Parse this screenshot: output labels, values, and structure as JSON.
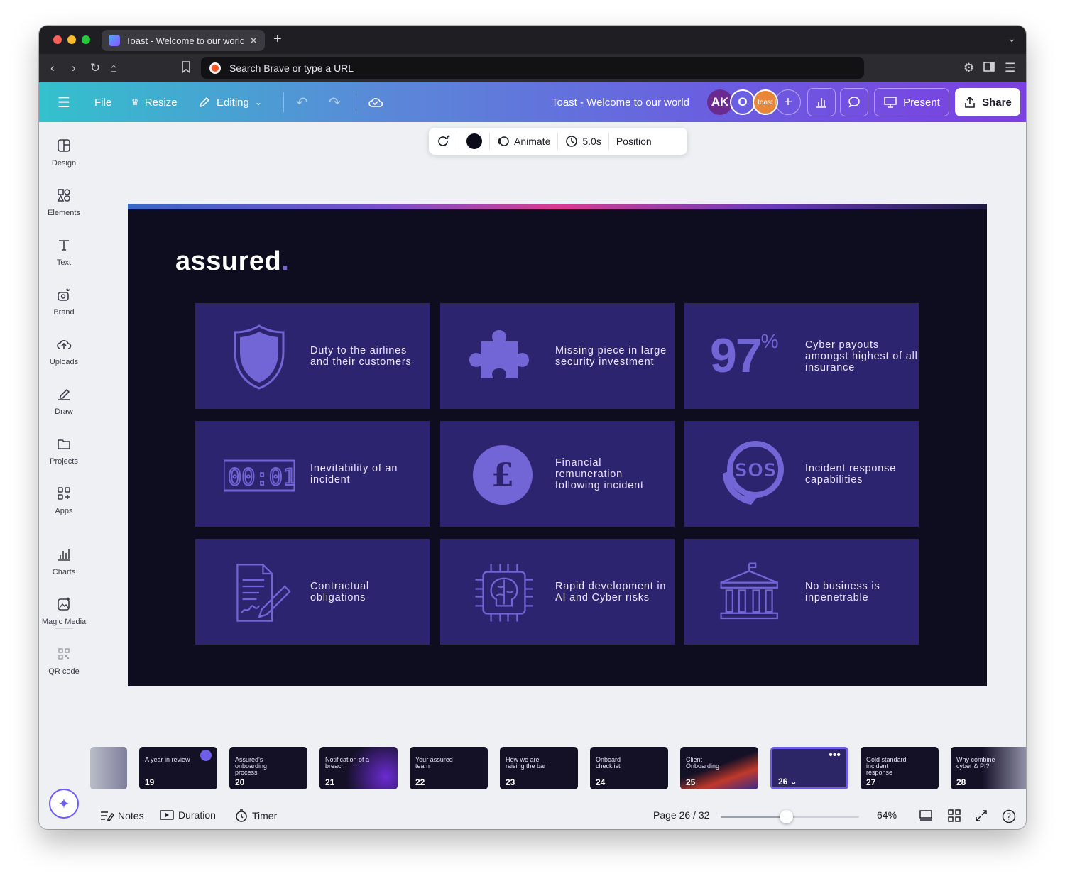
{
  "browser": {
    "tab_title": "Toast - Welcome to our world",
    "url_placeholder": "Search Brave or type a URL"
  },
  "header": {
    "file": "File",
    "resize": "Resize",
    "editing": "Editing",
    "doc_title": "Toast - Welcome to our world",
    "avatars": [
      {
        "label": "AK",
        "color": "#6a2a8f"
      },
      {
        "label": "O",
        "color": "#6a5fe0"
      },
      {
        "label": "toast",
        "color": "#e8873a"
      }
    ],
    "present": "Present",
    "share": "Share"
  },
  "sidebar": {
    "items": [
      {
        "label": "Design",
        "icon": "layout-icon"
      },
      {
        "label": "Elements",
        "icon": "shapes-icon"
      },
      {
        "label": "Text",
        "icon": "text-icon"
      },
      {
        "label": "Brand",
        "icon": "brand-icon"
      },
      {
        "label": "Uploads",
        "icon": "cloud-upload-icon"
      },
      {
        "label": "Draw",
        "icon": "pen-icon"
      },
      {
        "label": "Projects",
        "icon": "folder-icon"
      },
      {
        "label": "Apps",
        "icon": "apps-icon"
      },
      {
        "label": "Charts",
        "icon": "chart-icon"
      },
      {
        "label": "Magic Media",
        "icon": "magic-media-icon"
      },
      {
        "label": "QR code",
        "icon": "qr-icon"
      }
    ]
  },
  "toolbar": {
    "animate": "Animate",
    "duration": "5.0s",
    "position": "Position",
    "color": "#0c0b1a"
  },
  "slide": {
    "logo": "assured",
    "logo_dot": ".",
    "cards": [
      {
        "icon": "shield-icon",
        "label": "Duty to the airlines and their customers"
      },
      {
        "icon": "puzzle-icon",
        "label": "Missing piece in large security investment"
      },
      {
        "icon": "percent-stat",
        "stat": "97",
        "stat_unit": "%",
        "label": "Cyber payouts amongst highest of all insurance"
      },
      {
        "icon": "timer-display-icon",
        "label": "Inevitability of an incident"
      },
      {
        "icon": "pound-coin-icon",
        "label": "Financial remuneration following incident"
      },
      {
        "icon": "sos-phone-icon",
        "label": "Incident response capabilities"
      },
      {
        "icon": "contract-icon",
        "label": "Contractual obligations"
      },
      {
        "icon": "ai-brain-chip-icon",
        "label": "Rapid development in AI and Cyber risks"
      },
      {
        "icon": "bank-building-icon",
        "label": "No business is inpenetrable"
      }
    ],
    "colors": {
      "background": "#0e0c1f",
      "card": "#2d2470",
      "accent": "#7265d6"
    }
  },
  "thumbnails": [
    {
      "num": "",
      "title": ""
    },
    {
      "num": "19",
      "title": "A year in review"
    },
    {
      "num": "20",
      "title": "Assured's onboarding process"
    },
    {
      "num": "21",
      "title": "Notification of a breach"
    },
    {
      "num": "22",
      "title": "Your assured team"
    },
    {
      "num": "23",
      "title": "How we are raising the bar"
    },
    {
      "num": "24",
      "title": "Onboard checklist"
    },
    {
      "num": "25",
      "title": "Client Onboarding"
    },
    {
      "num": "26",
      "title": ""
    },
    {
      "num": "27",
      "title": "Gold standard incident response"
    },
    {
      "num": "28",
      "title": "Why combine cyber & PI?"
    }
  ],
  "footer": {
    "notes": "Notes",
    "duration": "Duration",
    "timer": "Timer",
    "page": "Page 26 / 32",
    "zoom_value": 0.47,
    "zoom": "64%"
  }
}
